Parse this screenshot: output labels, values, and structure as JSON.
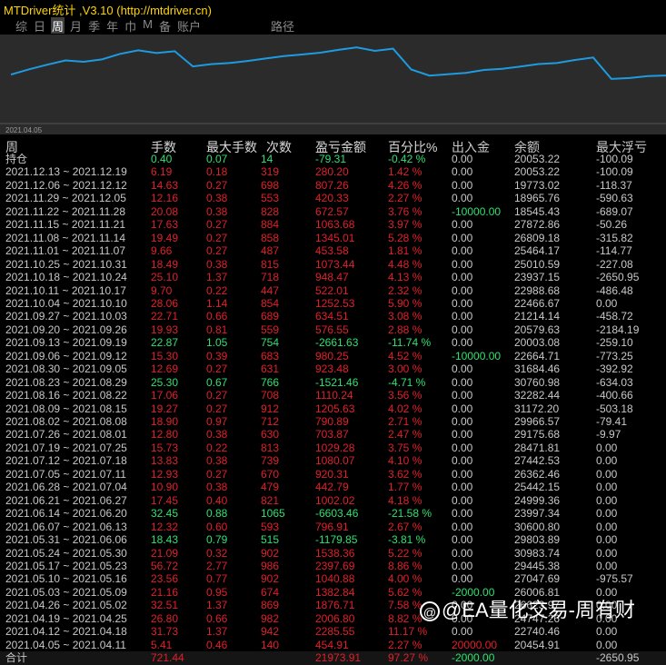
{
  "window": {
    "title": "MTDriver统计 ,V3.10 (http://mtdriver.cn)"
  },
  "tabs": [
    {
      "label": "综"
    },
    {
      "label": "日"
    },
    {
      "label": "周",
      "active": true
    },
    {
      "label": "月"
    },
    {
      "label": "季"
    },
    {
      "label": "年"
    },
    {
      "label": "巾"
    },
    {
      "label": "M"
    },
    {
      "label": "备"
    },
    {
      "label": "账户"
    },
    {
      "label": "路径"
    }
  ],
  "chart": {
    "start_label": "2021.04.05",
    "line_color": "#1e9be0"
  },
  "headers": {
    "period": "周",
    "lots": "手数",
    "max_lots": "最大手数",
    "trades": "次数",
    "pnl": "盈亏金额",
    "pct": "百分比%",
    "deposit": "出入金",
    "balance": "余额",
    "max_float": "最大浮亏"
  },
  "position": {
    "period": "持仓",
    "lots": "0.40",
    "max_lots": "0.07",
    "trades": "14",
    "pnl": "-79.31",
    "pct": "-0.42 %",
    "deposit": "0.00",
    "balance": "20053.22",
    "max_float": "-100.09"
  },
  "rows": [
    {
      "period": "2021.12.13 ~ 2021.12.19",
      "lots": "6.19",
      "max_lots": "0.18",
      "trades": "319",
      "pnl": "280.20",
      "pct": "1.42 %",
      "deposit": "0.00",
      "balance": "20053.22",
      "max_float": "-100.09"
    },
    {
      "period": "2021.12.06 ~ 2021.12.12",
      "lots": "14.63",
      "max_lots": "0.27",
      "trades": "698",
      "pnl": "807.26",
      "pct": "4.26 %",
      "deposit": "0.00",
      "balance": "19773.02",
      "max_float": "-118.37"
    },
    {
      "period": "2021.11.29 ~ 2021.12.05",
      "lots": "12.16",
      "max_lots": "0.38",
      "trades": "553",
      "pnl": "420.33",
      "pct": "2.27 %",
      "deposit": "0.00",
      "balance": "18965.76",
      "max_float": "-590.63"
    },
    {
      "period": "2021.11.22 ~ 2021.11.28",
      "lots": "20.08",
      "max_lots": "0.38",
      "trades": "828",
      "pnl": "672.57",
      "pct": "3.76 %",
      "deposit": "-10000.00",
      "balance": "18545.43",
      "max_float": "-689.07"
    },
    {
      "period": "2021.11.15 ~ 2021.11.21",
      "lots": "17.63",
      "max_lots": "0.27",
      "trades": "884",
      "pnl": "1063.68",
      "pct": "3.97 %",
      "deposit": "0.00",
      "balance": "27872.86",
      "max_float": "-50.26"
    },
    {
      "period": "2021.11.08 ~ 2021.11.14",
      "lots": "19.49",
      "max_lots": "0.27",
      "trades": "858",
      "pnl": "1345.01",
      "pct": "5.28 %",
      "deposit": "0.00",
      "balance": "26809.18",
      "max_float": "-315.82"
    },
    {
      "period": "2021.11.01 ~ 2021.11.07",
      "lots": "9.66",
      "max_lots": "0.27",
      "trades": "487",
      "pnl": "453.58",
      "pct": "1.81 %",
      "deposit": "0.00",
      "balance": "25464.17",
      "max_float": "-114.77"
    },
    {
      "period": "2021.10.25 ~ 2021.10.31",
      "lots": "18.49",
      "max_lots": "0.38",
      "trades": "815",
      "pnl": "1073.44",
      "pct": "4.48 %",
      "deposit": "0.00",
      "balance": "25010.59",
      "max_float": "-227.08"
    },
    {
      "period": "2021.10.18 ~ 2021.10.24",
      "lots": "25.10",
      "max_lots": "1.37",
      "trades": "718",
      "pnl": "948.47",
      "pct": "4.13 %",
      "deposit": "0.00",
      "balance": "23937.15",
      "max_float": "-2650.95"
    },
    {
      "period": "2021.10.11 ~ 2021.10.17",
      "lots": "9.70",
      "max_lots": "0.22",
      "trades": "447",
      "pnl": "522.01",
      "pct": "2.32 %",
      "deposit": "0.00",
      "balance": "22988.68",
      "max_float": "-486.48"
    },
    {
      "period": "2021.10.04 ~ 2021.10.10",
      "lots": "28.06",
      "max_lots": "1.14",
      "trades": "854",
      "pnl": "1252.53",
      "pct": "5.90 %",
      "deposit": "0.00",
      "balance": "22466.67",
      "max_float": "0.00"
    },
    {
      "period": "2021.09.27 ~ 2021.10.03",
      "lots": "22.71",
      "max_lots": "0.66",
      "trades": "689",
      "pnl": "634.51",
      "pct": "3.08 %",
      "deposit": "0.00",
      "balance": "21214.14",
      "max_float": "-458.72"
    },
    {
      "period": "2021.09.20 ~ 2021.09.26",
      "lots": "19.93",
      "max_lots": "0.81",
      "trades": "559",
      "pnl": "576.55",
      "pct": "2.88 %",
      "deposit": "0.00",
      "balance": "20579.63",
      "max_float": "-2184.19"
    },
    {
      "period": "2021.09.13 ~ 2021.09.19",
      "lots": "22.87",
      "max_lots": "1.05",
      "trades": "754",
      "pnl": "-2661.63",
      "pct": "-11.74 %",
      "deposit": "0.00",
      "balance": "20003.08",
      "max_float": "-259.10"
    },
    {
      "period": "2021.09.06 ~ 2021.09.12",
      "lots": "15.30",
      "max_lots": "0.39",
      "trades": "683",
      "pnl": "980.25",
      "pct": "4.52 %",
      "deposit": "-10000.00",
      "balance": "22664.71",
      "max_float": "-773.25"
    },
    {
      "period": "2021.08.30 ~ 2021.09.05",
      "lots": "12.69",
      "max_lots": "0.27",
      "trades": "631",
      "pnl": "923.48",
      "pct": "3.00 %",
      "deposit": "0.00",
      "balance": "31684.46",
      "max_float": "-392.92"
    },
    {
      "period": "2021.08.23 ~ 2021.08.29",
      "lots": "25.30",
      "max_lots": "0.67",
      "trades": "766",
      "pnl": "-1521.46",
      "pct": "-4.71 %",
      "deposit": "0.00",
      "balance": "30760.98",
      "max_float": "-634.03"
    },
    {
      "period": "2021.08.16 ~ 2021.08.22",
      "lots": "17.06",
      "max_lots": "0.27",
      "trades": "708",
      "pnl": "1110.24",
      "pct": "3.56 %",
      "deposit": "0.00",
      "balance": "32282.44",
      "max_float": "-400.66"
    },
    {
      "period": "2021.08.09 ~ 2021.08.15",
      "lots": "19.27",
      "max_lots": "0.27",
      "trades": "912",
      "pnl": "1205.63",
      "pct": "4.02 %",
      "deposit": "0.00",
      "balance": "31172.20",
      "max_float": "-503.18"
    },
    {
      "period": "2021.08.02 ~ 2021.08.08",
      "lots": "18.90",
      "max_lots": "0.97",
      "trades": "712",
      "pnl": "790.89",
      "pct": "2.71 %",
      "deposit": "0.00",
      "balance": "29966.57",
      "max_float": "-79.41"
    },
    {
      "period": "2021.07.26 ~ 2021.08.01",
      "lots": "12.80",
      "max_lots": "0.38",
      "trades": "630",
      "pnl": "703.87",
      "pct": "2.47 %",
      "deposit": "0.00",
      "balance": "29175.68",
      "max_float": "-9.97"
    },
    {
      "period": "2021.07.19 ~ 2021.07.25",
      "lots": "15.73",
      "max_lots": "0.22",
      "trades": "813",
      "pnl": "1029.28",
      "pct": "3.75 %",
      "deposit": "0.00",
      "balance": "28471.81",
      "max_float": "0.00"
    },
    {
      "period": "2021.07.12 ~ 2021.07.18",
      "lots": "13.83",
      "max_lots": "0.38",
      "trades": "739",
      "pnl": "1080.07",
      "pct": "4.10 %",
      "deposit": "0.00",
      "balance": "27442.53",
      "max_float": "0.00"
    },
    {
      "period": "2021.07.05 ~ 2021.07.11",
      "lots": "12.93",
      "max_lots": "0.27",
      "trades": "670",
      "pnl": "920.31",
      "pct": "3.62 %",
      "deposit": "0.00",
      "balance": "26362.46",
      "max_float": "0.00"
    },
    {
      "period": "2021.06.28 ~ 2021.07.04",
      "lots": "10.90",
      "max_lots": "0.38",
      "trades": "479",
      "pnl": "442.79",
      "pct": "1.77 %",
      "deposit": "0.00",
      "balance": "25442.15",
      "max_float": "0.00"
    },
    {
      "period": "2021.06.21 ~ 2021.06.27",
      "lots": "17.45",
      "max_lots": "0.40",
      "trades": "821",
      "pnl": "1002.02",
      "pct": "4.18 %",
      "deposit": "0.00",
      "balance": "24999.36",
      "max_float": "0.00"
    },
    {
      "period": "2021.06.14 ~ 2021.06.20",
      "lots": "32.45",
      "max_lots": "0.88",
      "trades": "1065",
      "pnl": "-6603.46",
      "pct": "-21.58 %",
      "deposit": "0.00",
      "balance": "23997.34",
      "max_float": "0.00"
    },
    {
      "period": "2021.06.07 ~ 2021.06.13",
      "lots": "12.32",
      "max_lots": "0.60",
      "trades": "593",
      "pnl": "796.91",
      "pct": "2.67 %",
      "deposit": "0.00",
      "balance": "30600.80",
      "max_float": "0.00"
    },
    {
      "period": "2021.05.31 ~ 2021.06.06",
      "lots": "18.43",
      "max_lots": "0.79",
      "trades": "515",
      "pnl": "-1179.85",
      "pct": "-3.81 %",
      "deposit": "0.00",
      "balance": "29803.89",
      "max_float": "0.00"
    },
    {
      "period": "2021.05.24 ~ 2021.05.30",
      "lots": "21.09",
      "max_lots": "0.32",
      "trades": "902",
      "pnl": "1538.36",
      "pct": "5.22 %",
      "deposit": "0.00",
      "balance": "30983.74",
      "max_float": "0.00"
    },
    {
      "period": "2021.05.17 ~ 2021.05.23",
      "lots": "56.72",
      "max_lots": "2.77",
      "trades": "986",
      "pnl": "2397.69",
      "pct": "8.86 %",
      "deposit": "0.00",
      "balance": "29445.38",
      "max_float": "0.00"
    },
    {
      "period": "2021.05.10 ~ 2021.05.16",
      "lots": "23.56",
      "max_lots": "0.77",
      "trades": "902",
      "pnl": "1040.88",
      "pct": "4.00 %",
      "deposit": "0.00",
      "balance": "27047.69",
      "max_float": "-975.57"
    },
    {
      "period": "2021.05.03 ~ 2021.05.09",
      "lots": "21.16",
      "max_lots": "0.95",
      "trades": "674",
      "pnl": "1382.84",
      "pct": "5.62 %",
      "deposit": "-2000.00",
      "balance": "26006.81",
      "max_float": "0.00"
    },
    {
      "period": "2021.04.26 ~ 2021.05.02",
      "lots": "32.51",
      "max_lots": "1.37",
      "trades": "869",
      "pnl": "1876.71",
      "pct": "7.58 %",
      "deposit": "0.00",
      "balance": "26623.97",
      "max_float": "0.00"
    },
    {
      "period": "2021.04.19 ~ 2021.04.25",
      "lots": "26.80",
      "max_lots": "0.66",
      "trades": "982",
      "pnl": "2006.80",
      "pct": "8.82 %",
      "deposit": "0.00",
      "balance": "24747.26",
      "max_float": "0.00"
    },
    {
      "period": "2021.04.12 ~ 2021.04.18",
      "lots": "31.73",
      "max_lots": "1.37",
      "trades": "942",
      "pnl": "2285.55",
      "pct": "11.17 %",
      "deposit": "0.00",
      "balance": "22740.46",
      "max_float": "0.00"
    },
    {
      "period": "2021.04.05 ~ 2021.04.11",
      "lots": "5.41",
      "max_lots": "0.46",
      "trades": "140",
      "pnl": "454.91",
      "pct": "2.27 %",
      "deposit": "20000.00",
      "balance": "20454.91",
      "max_float": "0.00"
    }
  ],
  "total": {
    "period": "合计",
    "lots": "721.44",
    "max_lots": "",
    "trades": "",
    "pnl": "21973.91",
    "pct": "97.27 %",
    "deposit": "-2000.00",
    "balance": "",
    "max_float": "-2650.95"
  },
  "watermark": "@EA量化交易-周有财"
}
